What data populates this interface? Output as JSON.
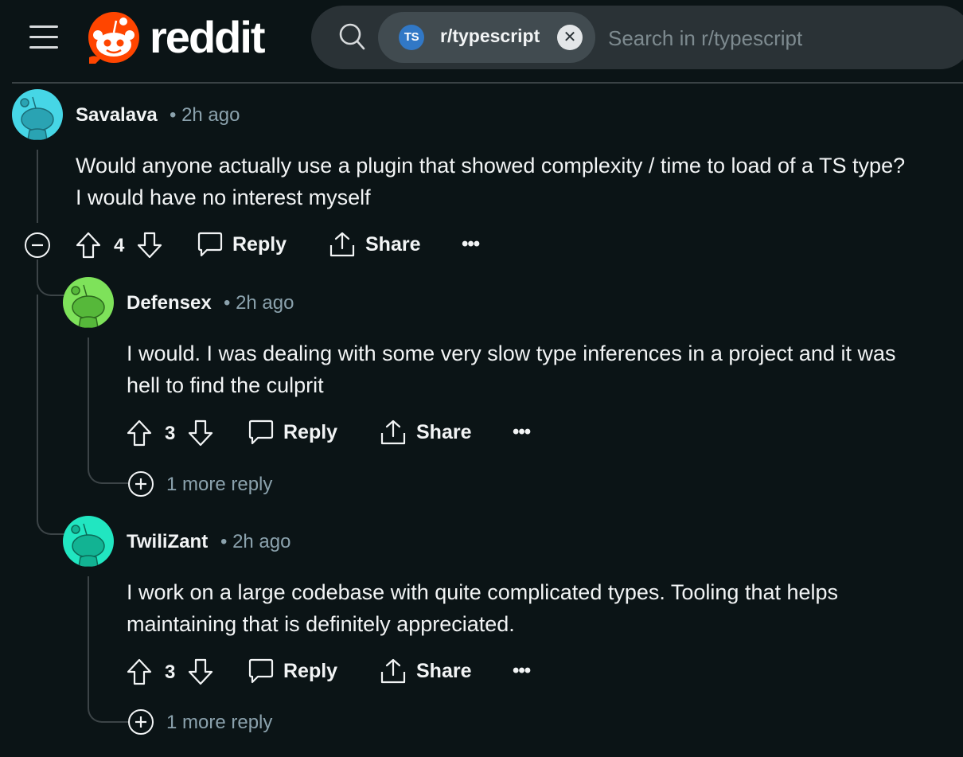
{
  "header": {
    "logo_text": "reddit",
    "subreddit_chip": {
      "icon_text": "TS",
      "label": "r/typescript",
      "close_glyph": "✕"
    },
    "search_placeholder": "Search in r/typescript"
  },
  "comments": [
    {
      "author": "Savalava",
      "time": "• 2h ago",
      "avatar_color": "#46d6e6",
      "body_lines": [
        "Would anyone actually use a plugin that showed complexity / time to load of a TS type?",
        "I would have no interest myself"
      ],
      "score": "4",
      "reply_label": "Reply",
      "share_label": "Share",
      "more_label": "•••"
    },
    {
      "author": "Defensex",
      "time": "• 2h ago",
      "avatar_color": "#7ee25a",
      "body_lines": [
        "I would. I was dealing with some very slow type inferences in a project and it was",
        "hell to find the culprit"
      ],
      "score": "3",
      "reply_label": "Reply",
      "share_label": "Share",
      "more_label": "•••",
      "more_replies": "1 more reply"
    },
    {
      "author": "TwiliZant",
      "time": "• 2h ago",
      "avatar_color": "#21e6c1",
      "body_lines": [
        "I work on a large codebase with quite complicated types. Tooling that helps",
        "maintaining that is definitely appreciated."
      ],
      "score": "3",
      "reply_label": "Reply",
      "share_label": "Share",
      "more_label": "•••",
      "more_replies": "1 more reply"
    }
  ],
  "colors": {
    "background": "#0b1416",
    "muted_text": "#8ba2ad",
    "brand": "#ff4500"
  }
}
